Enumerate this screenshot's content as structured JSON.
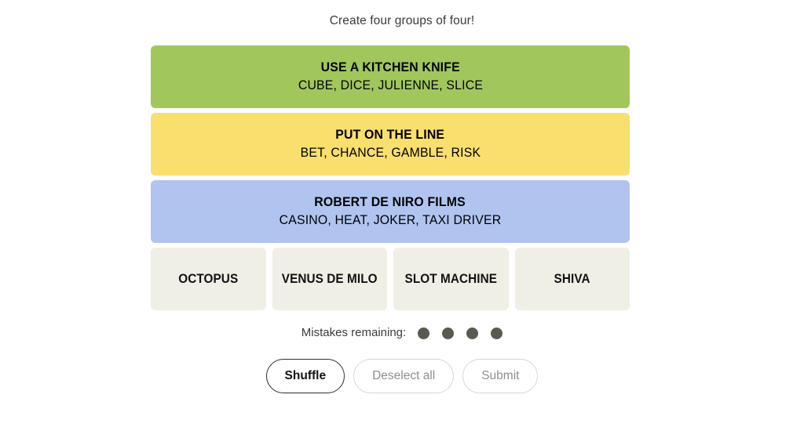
{
  "header": {
    "tagline": "Create four groups of four!"
  },
  "board": {
    "solved_groups": [
      {
        "title": "USE A KITCHEN KNIFE",
        "words": "CUBE, DICE, JULIENNE, SLICE",
        "color": "#a1c75c",
        "difficulty": "green"
      },
      {
        "title": "PUT ON THE LINE",
        "words": "BET, CHANCE, GAMBLE, RISK",
        "color": "#f9df6d",
        "difficulty": "yellow"
      },
      {
        "title": "ROBERT DE NIRO FILMS",
        "words": "CASINO, HEAT, JOKER, TAXI DRIVER",
        "color": "#b0c4ef",
        "difficulty": "blue"
      }
    ],
    "tiles": [
      {
        "label": "OCTOPUS"
      },
      {
        "label": "VENUS DE MILO"
      },
      {
        "label": "SLOT MACHINE"
      },
      {
        "label": "SHIVA"
      }
    ],
    "tile_color": "#efefe6"
  },
  "mistakes": {
    "label": "Mistakes remaining:",
    "remaining": 4,
    "dots": [
      1,
      2,
      3,
      4
    ],
    "dot_color": "#5a5a50"
  },
  "controls": {
    "shuffle": {
      "label": "Shuffle",
      "state": "enabled"
    },
    "deselect": {
      "label": "Deselect all",
      "state": "disabled"
    },
    "submit": {
      "label": "Submit",
      "state": "disabled"
    }
  }
}
